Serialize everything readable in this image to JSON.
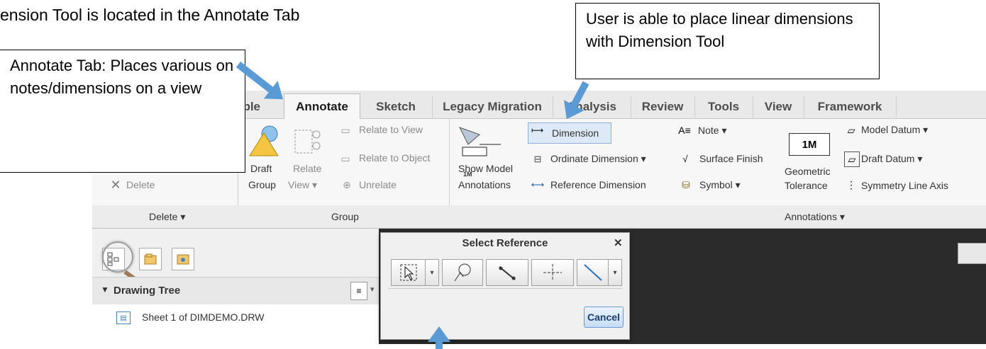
{
  "doc": {
    "caption": "ension Tool is located in the Annotate Tab",
    "callout_annotate": "Annotate Tab: Places various on notes/dimensions on a view",
    "callout_dimension": "User is able to place linear dimensions with Dimension Tool"
  },
  "tabs": [
    "able",
    "Annotate",
    "Sketch",
    "Legacy Migration",
    "Analysis",
    "Review",
    "Tools",
    "View",
    "Framework"
  ],
  "active_tab": "Annotate",
  "ribbon": {
    "delete": "Delete",
    "draft_group": "Draft\nGroup",
    "draft": "Draft",
    "group": "Group",
    "relate": "Relate",
    "view_dd": "View ▾",
    "relate_to_view": "Relate to View",
    "relate_to_object": "Relate to Object",
    "unrelate": "Unrelate",
    "show_model": "Show Model",
    "annotations": "Annotations",
    "dimension": "Dimension",
    "ordinate_dimension": "Ordinate Dimension ▾",
    "reference_dimension": "Reference Dimension",
    "note": "Note ▾",
    "surface_finish": "Surface Finish",
    "symbol": "Symbol ▾",
    "geometric": "Geometric",
    "tolerance": "Tolerance",
    "model_datum": "Model Datum ▾",
    "draft_datum": "Draft Datum ▾",
    "symmetry_line_axis": "Symmetry Line Axis",
    "gtol_icon_text": "1M",
    "show_model_icon_text": "1M"
  },
  "groups": {
    "delete": "Delete ▾",
    "group": "Group",
    "annotations": "Annotations ▾"
  },
  "sidebar": {
    "drawing_tree": "Drawing Tree",
    "sheet": "Sheet 1 of DIMDEMO.DRW"
  },
  "dialog": {
    "title": "Select Reference",
    "close": "✕",
    "cancel": "Cancel"
  },
  "colors": {
    "arrow": "#5b9bd5",
    "canvas": "#2b2b2b"
  }
}
